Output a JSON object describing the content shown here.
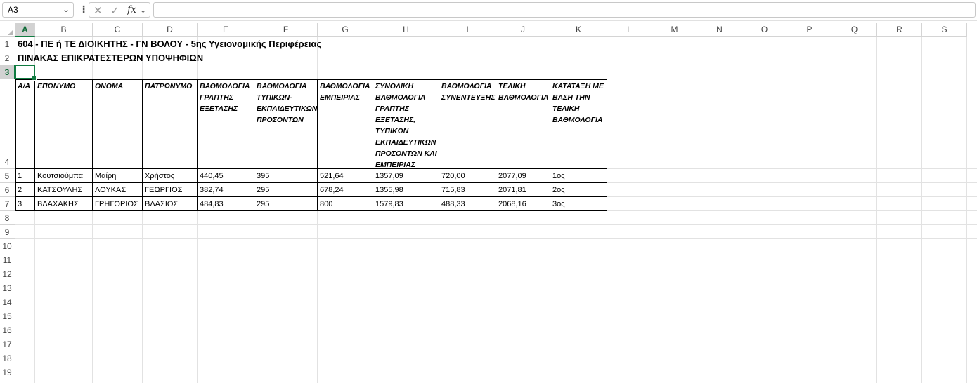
{
  "formula_bar": {
    "name_box": "A3",
    "cancel_icon": "close-icon",
    "enter_icon": "check-icon",
    "fx_label": "fx",
    "formula_value": ""
  },
  "columns": [
    "A",
    "B",
    "C",
    "D",
    "E",
    "F",
    "G",
    "H",
    "I",
    "J",
    "K",
    "L",
    "M",
    "N",
    "O",
    "P",
    "Q",
    "R",
    "S"
  ],
  "rows": [
    "1",
    "2",
    "3",
    "4",
    "5",
    "6",
    "7",
    "8",
    "9",
    "10",
    "11",
    "12",
    "13",
    "14",
    "15",
    "16",
    "17",
    "18",
    "19"
  ],
  "selected_cell": "A3",
  "sheet": {
    "title1": "604 - ΠΕ ή ΤΕ ΔΙΟΙΚΗΤΗΣ - ΓΝ ΒΟΛΟΥ - 5ης Υγειονομικής Περιφέρειας",
    "title2": "ΠΙΝΑΚΑΣ ΕΠΙΚΡΑΤΕΣΤΕΡΩΝ ΥΠΟΨΗΦΙΩΝ",
    "table_headers": [
      "Α/Α",
      "ΕΠΩΝΥΜΟ",
      "ΟΝΟΜΑ",
      "ΠΑΤΡΩΝΥΜΟ",
      "ΒΑΘΜΟΛΟΓΙΑ ΓΡΑΠΤΗΣ ΕΞΕΤΑΣΗΣ",
      "ΒΑΘΜΟΛΟΓΙΑ ΤΥΠΙΚΩΝ-ΕΚΠΑΙΔΕΥΤΙΚΩΝ ΠΡΟΣΟΝΤΩΝ",
      "ΒΑΘΜΟΛΟΓΙΑ ΕΜΠΕΙΡΙΑΣ",
      "ΣΥΝΟΛΙΚΗ ΒΑΘΜΟΛΟΓΙΑ ΓΡΑΠΤΗΣ ΕΞΕΤΑΣΗΣ, ΤΥΠΙΚΩΝ ΕΚΠΑΙΔΕΥΤΙΚΩΝ ΠΡΟΣΟΝΤΩΝ ΚΑΙ ΕΜΠΕΙΡΙΑΣ",
      "ΒΑΘΜΟΛΟΓΙΑ ΣΥΝΕΝΤΕΥΞΗΣ",
      "ΤΕΛΙΚΗ ΒΑΘΜΟΛΟΓΙΑ",
      "ΚΑΤΑΤΑΞΗ ΜΕ ΒΑΣΗ ΤΗΝ ΤΕΛΙΚΗ ΒΑΘΜΟΛΟΓΙΑ"
    ],
    "table_rows": [
      [
        "1",
        "Κουτσιούμπα",
        "Μαίρη",
        "Χρήστος",
        "440,45",
        "395",
        "521,64",
        "1357,09",
        "720,00",
        "2077,09",
        "1ος"
      ],
      [
        "2",
        "ΚΑΤΣΟΥΛΗΣ",
        "ΛΟΥΚΑΣ",
        "ΓΕΩΡΓΙΟΣ",
        "382,74",
        "295",
        "678,24",
        "1355,98",
        "715,83",
        "2071,81",
        "2ος"
      ],
      [
        "3",
        "ΒΛΑΧΑΚΗΣ",
        "ΓΡΗΓΟΡΙΟΣ",
        "ΒΛΑΣΙΟΣ",
        "484,83",
        "295",
        "800",
        "1579,83",
        "488,33",
        "2068,16",
        "3ος"
      ]
    ]
  }
}
